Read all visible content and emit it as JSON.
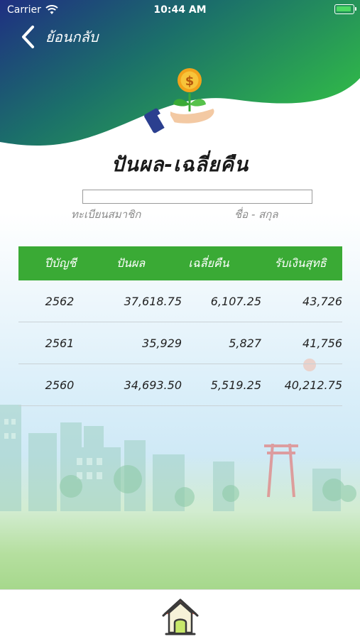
{
  "status_bar": {
    "carrier": "Carrier",
    "time": "10:44 AM"
  },
  "nav": {
    "back_label": "ย้อนกลับ"
  },
  "page": {
    "title": "ปันผล-เฉลี่ยคืน"
  },
  "form": {
    "member_id_label": "ทะเบียนสมาชิก",
    "name_label": "ชื่อ - สกุล",
    "member_id_value": "",
    "name_value": ""
  },
  "table": {
    "headers": [
      "ปีบัญชี",
      "ปันผล",
      "เฉลี่ยคืน",
      "รับเงินสุทธิ"
    ],
    "rows": [
      [
        "2562",
        "37,618.75",
        "6,107.25",
        "43,726"
      ],
      [
        "2561",
        "35,929",
        "5,827",
        "41,756"
      ],
      [
        "2560",
        "34,693.50",
        "5,519.25",
        "40,212.75"
      ]
    ]
  },
  "colors": {
    "header_gradient_start": "#1f3a8a",
    "header_gradient_end": "#2db34a",
    "table_header": "#3aaa35"
  },
  "icons": {
    "back": "chevron-left-icon",
    "hero": "money-plant-hand-icon",
    "home": "home-icon"
  }
}
